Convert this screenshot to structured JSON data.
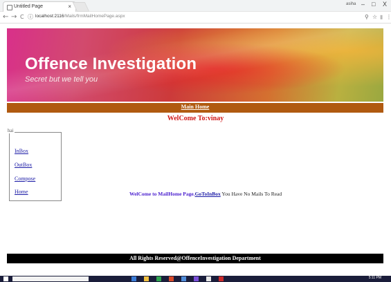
{
  "browser": {
    "tab_title": "Untitled Page",
    "tab_close": "×",
    "url_host": "localhost:2116",
    "url_path": "/Mails/frmMailHomePage.aspx",
    "back": "←",
    "forward": "→",
    "reload": "C",
    "window_user": "asiha",
    "minimize": "–",
    "maximize": "□",
    "close": "X"
  },
  "banner": {
    "title": "Offence Investigation",
    "subtitle": "Secret but we tell you"
  },
  "menu": {
    "main_home": "Main Home"
  },
  "welcome": "WelCome To:vinay",
  "sidebar": {
    "legend": "hai",
    "links": [
      {
        "label": "InBox"
      },
      {
        "label": "OutBox"
      },
      {
        "label": "Compose"
      },
      {
        "label": "Home"
      }
    ]
  },
  "message": {
    "prefix": "WelCome to MailHome Page.",
    "link": "GoToInBox",
    "suffix": " You Have No Mails To Read"
  },
  "footer": "All Rights Reserved@OffenceInvestigation Department",
  "taskbar": {
    "time": "5:11 PM"
  },
  "colors": {
    "menubar": "#b05a10",
    "welcome_text": "#d01818",
    "link": "#1a1aa6",
    "message_accent": "#4a1fcf",
    "footer_bg": "#000000"
  }
}
